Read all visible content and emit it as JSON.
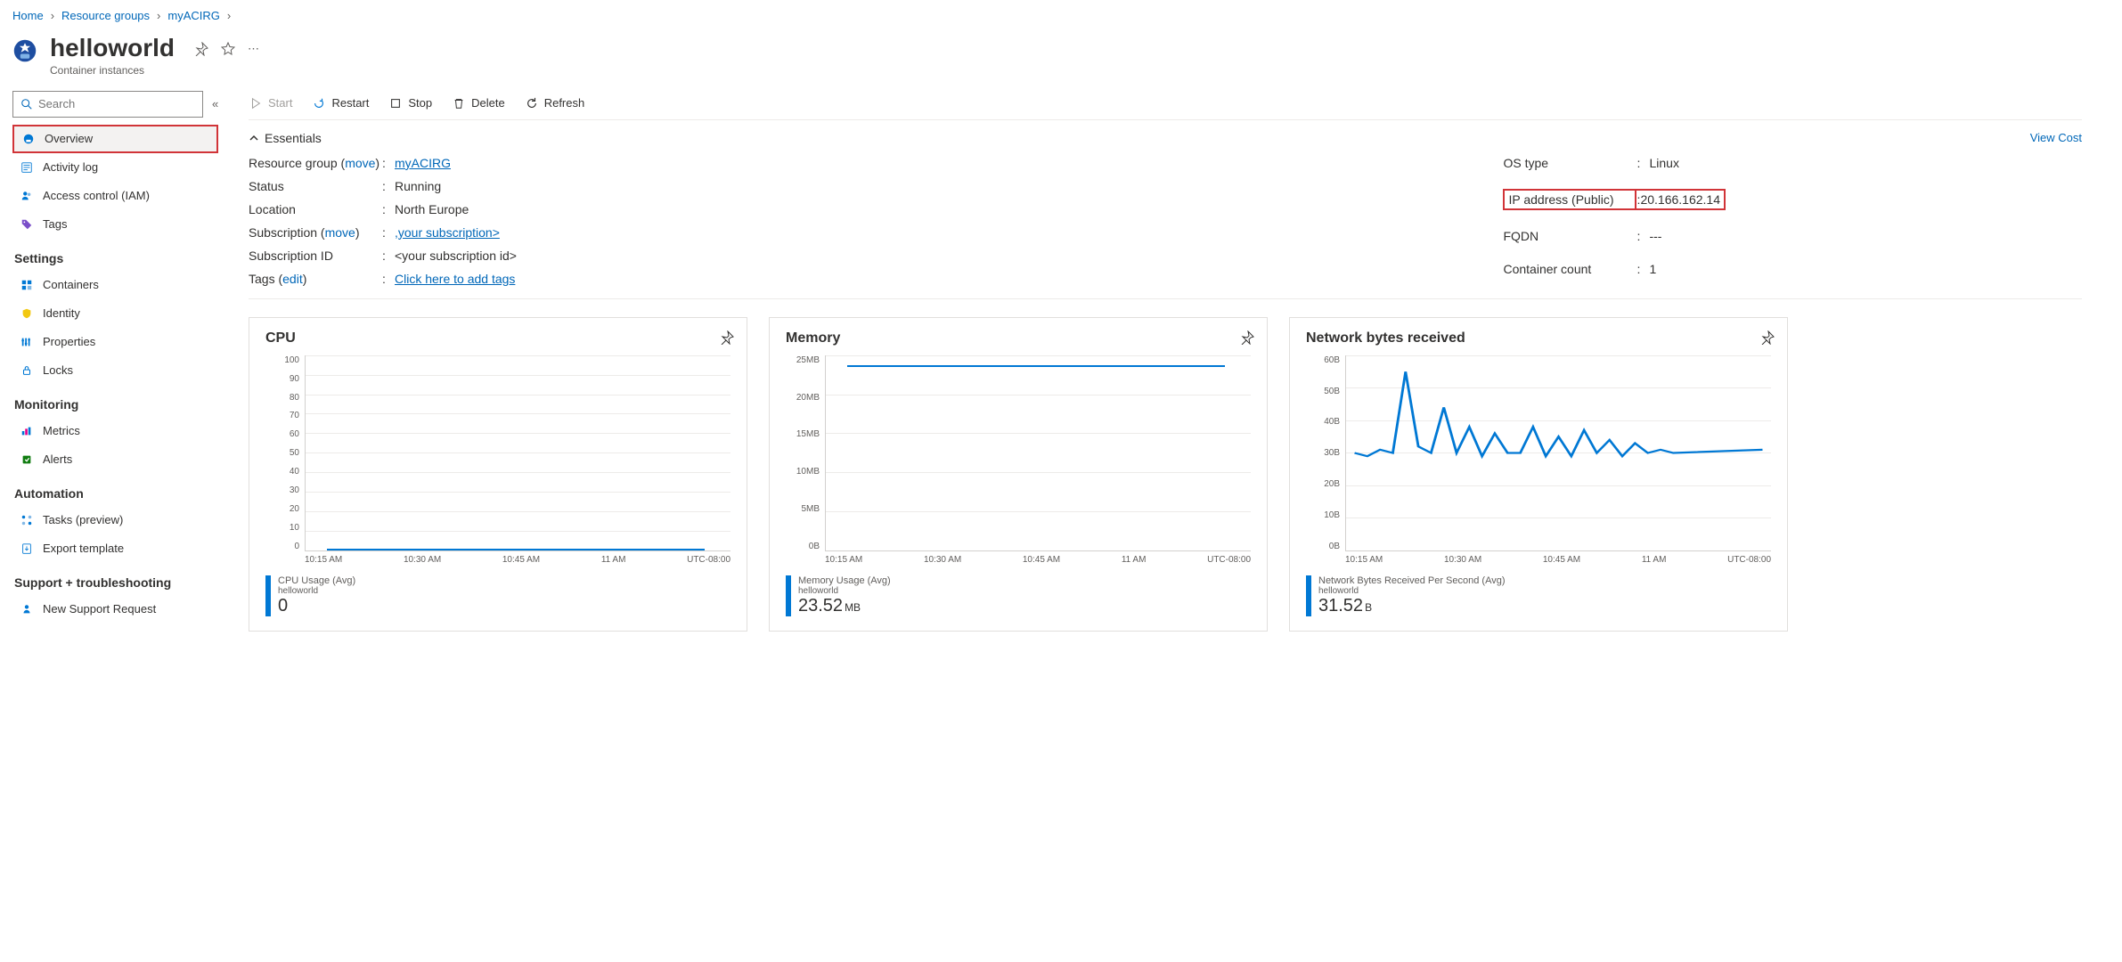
{
  "breadcrumb": {
    "home": "Home",
    "rg": "Resource groups",
    "group": "myACIRG"
  },
  "header": {
    "title": "helloworld",
    "subtitle": "Container instances"
  },
  "search": {
    "placeholder": "Search"
  },
  "nav": {
    "overview": "Overview",
    "activity_log": "Activity log",
    "iam": "Access control (IAM)",
    "tags": "Tags",
    "section_settings": "Settings",
    "containers": "Containers",
    "identity": "Identity",
    "properties": "Properties",
    "locks": "Locks",
    "section_monitoring": "Monitoring",
    "metrics": "Metrics",
    "alerts": "Alerts",
    "section_automation": "Automation",
    "tasks": "Tasks (preview)",
    "export_template": "Export template",
    "section_support": "Support + troubleshooting",
    "new_support": "New Support Request"
  },
  "toolbar": {
    "start": "Start",
    "restart": "Restart",
    "stop": "Stop",
    "delete": "Delete",
    "refresh": "Refresh"
  },
  "essentials": {
    "label": "Essentials",
    "view_cost": "View Cost",
    "left": {
      "rg_label": "Resource group",
      "rg_move": "move",
      "rg_value": "myACIRG",
      "status_label": "Status",
      "status_value": "Running",
      "location_label": "Location",
      "location_value": "North Europe",
      "sub_label": "Subscription",
      "sub_move": "move",
      "sub_value": ",your subscription>",
      "subid_label": "Subscription ID",
      "subid_value": "<your subscription id>",
      "tags_label": "Tags",
      "tags_edit": "edit",
      "tags_value": "Click here to add tags"
    },
    "right": {
      "os_label": "OS type",
      "os_value": "Linux",
      "ip_label": "IP address (Public)",
      "ip_value": "20.166.162.14",
      "fqdn_label": "FQDN",
      "fqdn_value": "---",
      "cc_label": "Container count",
      "cc_value": "1"
    }
  },
  "charts": {
    "tz": "UTC-08:00",
    "xticks": [
      "10:15 AM",
      "10:30 AM",
      "10:45 AM",
      "11 AM"
    ],
    "cpu": {
      "title": "CPU",
      "yticks": [
        "100",
        "90",
        "80",
        "70",
        "60",
        "50",
        "40",
        "30",
        "20",
        "10",
        "0"
      ],
      "legend_title": "CPU Usage (Avg)",
      "legend_sub": "helloworld",
      "legend_value": "0",
      "legend_unit": ""
    },
    "mem": {
      "title": "Memory",
      "yticks": [
        "25MB",
        "20MB",
        "15MB",
        "10MB",
        "5MB",
        "0B"
      ],
      "legend_title": "Memory Usage (Avg)",
      "legend_sub": "helloworld",
      "legend_value": "23.52",
      "legend_unit": "MB"
    },
    "net": {
      "title": "Network bytes received",
      "yticks": [
        "60B",
        "50B",
        "40B",
        "30B",
        "20B",
        "10B",
        "0B"
      ],
      "legend_title": "Network Bytes Received Per Second (Avg)",
      "legend_sub": "helloworld",
      "legend_value": "31.52",
      "legend_unit": "B"
    }
  },
  "chart_data": [
    {
      "type": "line",
      "title": "CPU",
      "ylabel": "CPU Usage (Avg)",
      "ylim": [
        0,
        100
      ],
      "x": [
        "10:15 AM",
        "10:30 AM",
        "10:45 AM",
        "11 AM"
      ],
      "series": [
        {
          "name": "helloworld",
          "values": [
            0,
            0,
            0,
            0
          ]
        }
      ]
    },
    {
      "type": "line",
      "title": "Memory",
      "ylabel": "Memory Usage (Avg)",
      "ylim": [
        0,
        25
      ],
      "yunit": "MB",
      "x": [
        "10:15 AM",
        "10:30 AM",
        "10:45 AM",
        "11 AM"
      ],
      "series": [
        {
          "name": "helloworld",
          "values": [
            23.5,
            23.5,
            23.5,
            23.5
          ]
        }
      ]
    },
    {
      "type": "line",
      "title": "Network bytes received",
      "ylabel": "Network Bytes Received Per Second (Avg)",
      "ylim": [
        0,
        60
      ],
      "yunit": "B",
      "x": [
        "10:13",
        "10:15",
        "10:17",
        "10:19",
        "10:21",
        "10:23",
        "10:25",
        "10:27",
        "10:29",
        "10:31",
        "10:33",
        "10:35",
        "10:37",
        "10:39",
        "10:41",
        "10:43",
        "10:45",
        "10:47",
        "10:49",
        "10:51",
        "10:53",
        "10:55",
        "10:57",
        "10:59",
        "11:01",
        "11:03",
        "11:05"
      ],
      "series": [
        {
          "name": "helloworld",
          "values": [
            30,
            29,
            31,
            30,
            55,
            32,
            30,
            44,
            30,
            38,
            29,
            36,
            30,
            30,
            38,
            29,
            35,
            29,
            37,
            30,
            34,
            29,
            33,
            30,
            31,
            30,
            31
          ]
        }
      ]
    }
  ]
}
